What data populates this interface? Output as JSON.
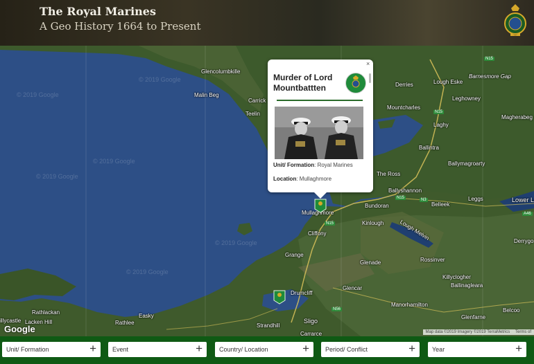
{
  "header": {
    "title": "The Royal Marines",
    "subtitle": "A Geo History 1664 to Present",
    "crest_icon": "royal-marines-crest"
  },
  "map": {
    "watermark": "© 2019 Google",
    "google_logo": "Google",
    "attribution": "Map data ©2019 Imagery ©2019 TerraMetrics",
    "terms": "Terms of",
    "places": {
      "glencolumbkille": "Glencolumbkille",
      "malin_beg": "Malin Beg",
      "carrick": "Carrick",
      "teelin": "Teelin",
      "derries": "Derries",
      "mountcharles": "Mountcharles",
      "lough_eske": "Lough Eske",
      "barnesmore_gap": "Barnesmore Gap",
      "leghowney": "Leghowney",
      "laghy": "Laghy",
      "magherabeg": "Magherabeg",
      "ballintra": "Ballintra",
      "ballymagroarty": "Ballymagroarty",
      "the_ross": "The Ross",
      "ballyshannon": "Ballyshannon",
      "belleek": "Belleek",
      "leggs": "Leggs",
      "lower_lough": "Lower Lo",
      "bundoran": "Bundoran",
      "mullaghmore": "Mullaghmore",
      "kinlough": "Kinlough",
      "lough_melvin": "Lough Melvin",
      "derrygo": "Derrygo",
      "cliffony": "Cliffony",
      "grange": "Grange",
      "rossinver": "Rossinver",
      "glenade": "Glenade",
      "killyclogher": "Killyclogher",
      "ballinagleara": "Ballinagleara",
      "glencar": "Glencar",
      "drumcliff": "Drumcliff",
      "rathlackan": "Rathlackan",
      "lacken_hill": "Lacken Hill",
      "killycastle": "illycastle",
      "rathlee": "Rathlee",
      "easky": "Easky",
      "strandhill": "Strandhill",
      "sligo": "Sligo",
      "carrarce": "Carrarce",
      "manorhamilton": "Manorhamilton",
      "glenfarne": "Glenfarne",
      "belcoo": "Belcoo"
    },
    "roads": [
      "N15",
      "N15",
      "N15",
      "N3",
      "N15",
      "A46",
      "N56"
    ]
  },
  "popup": {
    "title": "Murder of Lord Mountbattten",
    "close": "×",
    "unit_label": "Unit/ Formation",
    "unit_value": "Royal Marines",
    "location_label": "Location",
    "location_value": "Mullaghmore"
  },
  "filters": [
    {
      "label": "Unit/ Formation",
      "icon": "plus-icon"
    },
    {
      "label": "Event",
      "icon": "plus-icon"
    },
    {
      "label": "Country/ Location",
      "icon": "plus-icon"
    },
    {
      "label": "Period/ Conflict",
      "icon": "plus-icon"
    },
    {
      "label": "Year",
      "icon": "plus-icon"
    }
  ],
  "colors": {
    "header_bg": "#2e2a20",
    "filter_bar": "#0f5a14",
    "marker": "#1f8a3a",
    "sea": "#2d4f86",
    "land": "#3f5a2c"
  }
}
